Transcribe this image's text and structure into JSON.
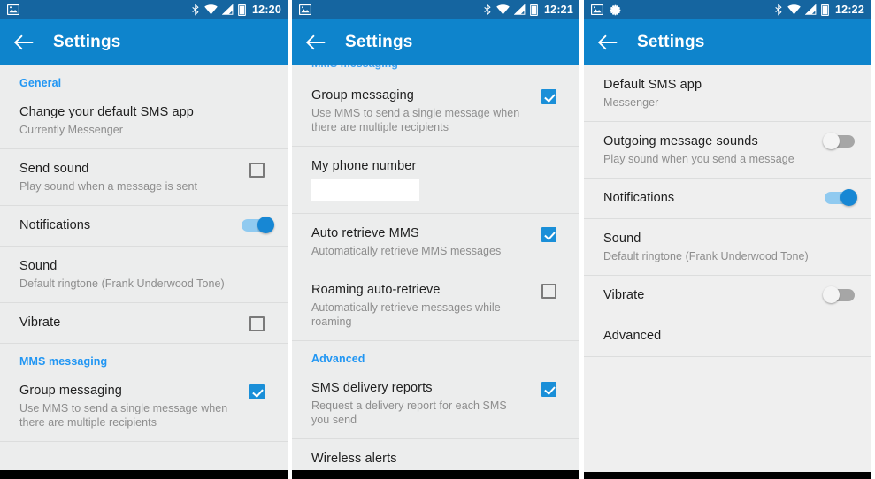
{
  "colors": {
    "status_bar": "#1565a0",
    "app_bar": "#0e84cc",
    "accent": "#2196f3",
    "checkbox_on": "#1a8fd8",
    "toggle_on_track": "#90caf0",
    "toggle_on_knob": "#1787d4",
    "toggle_off_track": "#a6a6a6",
    "list_bg": "#eceded",
    "title_text": "#1f1f1f",
    "sub_text": "#8d8d8d"
  },
  "screens": [
    {
      "id": "screen-1",
      "status_bar": {
        "left_icons": [
          "image-icon"
        ],
        "right_icons": [
          "bluetooth-icon",
          "wifi-icon",
          "signal-icon",
          "battery-icon"
        ],
        "time": "12:20"
      },
      "app_bar": {
        "back_icon": "back-arrow-icon",
        "title": "Settings"
      },
      "ghost_label": null,
      "items": [
        {
          "type": "section",
          "label": "General"
        },
        {
          "type": "row",
          "title": "Change your default SMS app",
          "subtitle": "Currently Messenger",
          "control": "none"
        },
        {
          "type": "row",
          "title": "Send sound",
          "subtitle": "Play sound when a message is sent",
          "control": "checkbox",
          "checked": false
        },
        {
          "type": "row",
          "title": "Notifications",
          "subtitle": "",
          "control": "toggle",
          "checked": true
        },
        {
          "type": "row",
          "title": "Sound",
          "subtitle": "Default ringtone (Frank Underwood Tone)",
          "control": "none"
        },
        {
          "type": "row",
          "title": "Vibrate",
          "subtitle": "",
          "control": "checkbox",
          "checked": false
        },
        {
          "type": "section",
          "label": "MMS messaging"
        },
        {
          "type": "row",
          "title": "Group messaging",
          "subtitle": "Use MMS to send a single message when there are multiple recipients",
          "control": "checkbox",
          "checked": true
        }
      ]
    },
    {
      "id": "screen-2",
      "status_bar": {
        "left_icons": [
          "image-icon"
        ],
        "right_icons": [
          "bluetooth-icon",
          "wifi-icon",
          "signal-icon",
          "battery-icon"
        ],
        "time": "12:21"
      },
      "app_bar": {
        "back_icon": "back-arrow-icon",
        "title": "Settings"
      },
      "ghost_label": "MMS messaging",
      "items": [
        {
          "type": "row",
          "title": "Group messaging",
          "subtitle": "Use MMS to send a single message when there are multiple recipients",
          "control": "checkbox",
          "checked": true
        },
        {
          "type": "row",
          "title": "My phone number",
          "subtitle": "",
          "control": "redacted-value"
        },
        {
          "type": "row",
          "title": "Auto retrieve MMS",
          "subtitle": "Automatically retrieve MMS messages",
          "control": "checkbox",
          "checked": true
        },
        {
          "type": "row",
          "title": "Roaming auto-retrieve",
          "subtitle": "Automatically retrieve messages while roaming",
          "control": "checkbox",
          "checked": false
        },
        {
          "type": "section",
          "label": "Advanced"
        },
        {
          "type": "row",
          "title": "SMS delivery reports",
          "subtitle": "Request a delivery report for each SMS you send",
          "control": "checkbox",
          "checked": true
        },
        {
          "type": "row",
          "title": "Wireless alerts",
          "subtitle": "",
          "control": "none"
        }
      ]
    },
    {
      "id": "screen-3",
      "status_bar": {
        "left_icons": [
          "image-icon",
          "asterisk-icon"
        ],
        "right_icons": [
          "bluetooth-icon",
          "wifi-icon",
          "signal-icon",
          "battery-icon"
        ],
        "time": "12:22"
      },
      "app_bar": {
        "back_icon": "back-arrow-icon",
        "title": "Settings"
      },
      "ghost_label": null,
      "items": [
        {
          "type": "row",
          "title": "Default SMS app",
          "subtitle": "Messenger",
          "control": "none"
        },
        {
          "type": "row",
          "title": "Outgoing message sounds",
          "subtitle": "Play sound when you send a message",
          "control": "toggle",
          "checked": false
        },
        {
          "type": "row",
          "title": "Notifications",
          "subtitle": "",
          "control": "toggle",
          "checked": true
        },
        {
          "type": "row",
          "title": "Sound",
          "subtitle": "Default ringtone (Frank Underwood Tone)",
          "control": "none"
        },
        {
          "type": "row",
          "title": "Vibrate",
          "subtitle": "",
          "control": "toggle",
          "checked": false
        },
        {
          "type": "row",
          "title": "Advanced",
          "subtitle": "",
          "control": "none"
        }
      ]
    }
  ]
}
